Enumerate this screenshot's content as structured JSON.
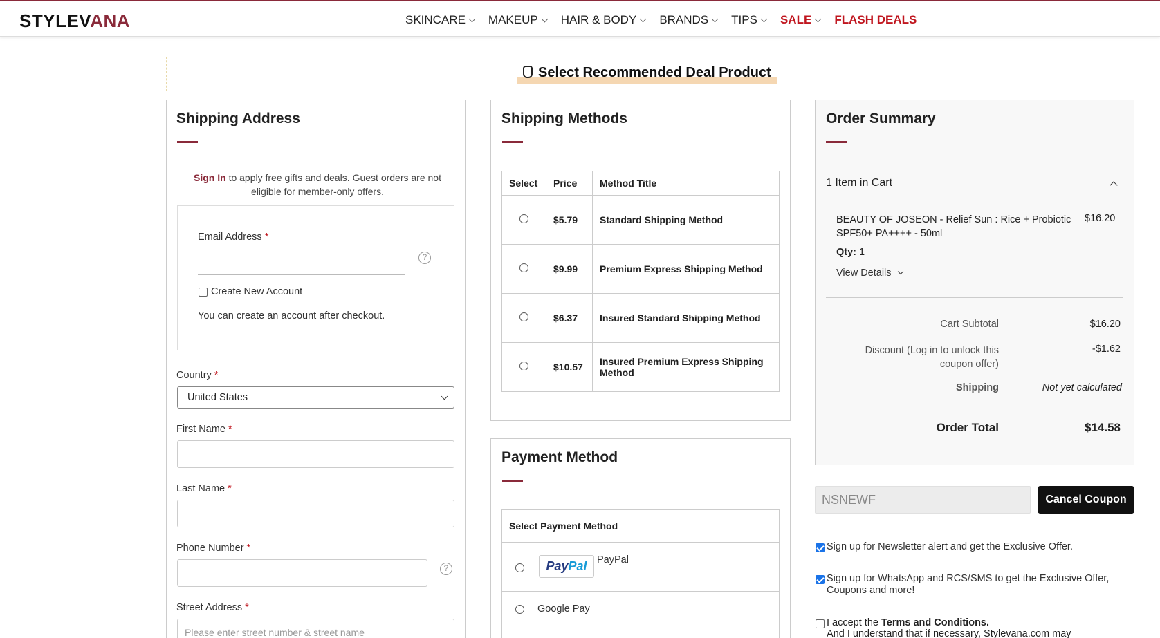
{
  "header": {
    "logo_main": "STYLEV",
    "logo_accent": "ANA",
    "nav": [
      {
        "label": "SKINCARE"
      },
      {
        "label": "MAKEUP"
      },
      {
        "label": "HAIR & BODY"
      },
      {
        "label": "BRANDS"
      },
      {
        "label": "TIPS"
      },
      {
        "label": "SALE"
      },
      {
        "label": "FLASH DEALS"
      }
    ]
  },
  "deal_banner": {
    "label": "Select Recommended Deal Product"
  },
  "shipping_address": {
    "title": "Shipping Address",
    "sign_in_link": "Sign In",
    "sign_in_note": " to apply free gifts and deals. Guest orders are not eligible for member-only offers.",
    "email_label": "Email Address",
    "create_account_label": "Create New Account",
    "create_account_note": "You can create an account after checkout.",
    "country_label": "Country",
    "country_value": "United States",
    "first_name_label": "First Name",
    "last_name_label": "Last Name",
    "phone_label": "Phone Number",
    "street_label": "Street Address",
    "street_placeholder": "Please enter street number & street name",
    "required_mark": "*",
    "help_mark": "?"
  },
  "shipping_methods": {
    "title": "Shipping Methods",
    "headers": [
      "Select",
      "Price",
      "Method Title"
    ],
    "rows": [
      {
        "price": "$5.79",
        "title": "Standard Shipping Method"
      },
      {
        "price": "$9.99",
        "title": "Premium Express Shipping Method"
      },
      {
        "price": "$6.37",
        "title": "Insured Standard Shipping Method"
      },
      {
        "price": "$10.57",
        "title": "Insured Premium Express Shipping Method"
      }
    ]
  },
  "payment_method": {
    "title": "Payment Method",
    "select_label": "Select Payment Method",
    "paypal_logo_pay": "Pay",
    "paypal_logo_pal": "Pal",
    "paypal_label": "PayPal",
    "google_pay_label": "Google Pay"
  },
  "order_summary": {
    "title": "Order Summary",
    "items_in_cart": "1 Item in Cart",
    "item_name": "BEAUTY OF JOSEON - Relief Sun : Rice + Probiotic SPF50+ PA++++ - 50ml",
    "item_price": "$16.20",
    "qty_label": "Qty:",
    "qty_value": "1",
    "view_details": "View Details",
    "subtotal_label": "Cart Subtotal",
    "subtotal_value": "$16.20",
    "discount_label": "Discount (Log in to unlock this coupon offer)",
    "discount_value": "-$1.62",
    "shipping_label": "Shipping",
    "shipping_value": "Not yet calculated",
    "total_label": "Order Total",
    "total_value": "$14.58"
  },
  "coupon": {
    "code": "NSNEWF",
    "cancel_label": "Cancel Coupon"
  },
  "consents": {
    "newsletter": "Sign up for Newsletter alert and get the Exclusive Offer.",
    "whatsapp": "Sign up for WhatsApp and RCS/SMS to get the Exclusive Offer, Coupons and more!",
    "terms_prefix": "I accept the ",
    "terms_link": "Terms and Conditions.",
    "terms_suffix": "And I understand that if necessary, Stylevana.com may"
  }
}
